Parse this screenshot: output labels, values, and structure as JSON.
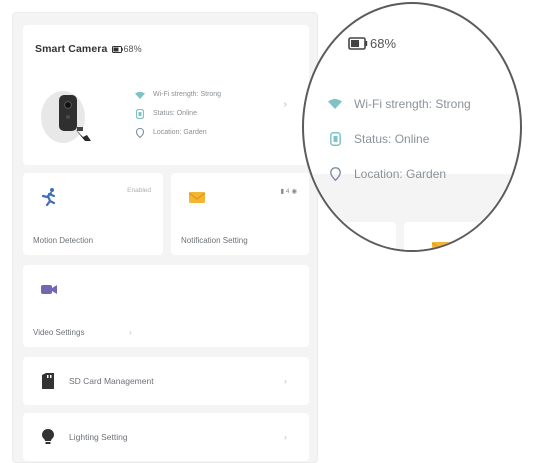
{
  "device": {
    "name": "Smart Camera",
    "battery": "68%",
    "info": [
      {
        "icon": "wifi-icon",
        "text": "Wi-Fi strength: Strong"
      },
      {
        "icon": "status-icon",
        "text": "Status: Online"
      },
      {
        "icon": "location-icon",
        "text": "Location: Garden"
      }
    ]
  },
  "tiles": {
    "motion": {
      "label": "Motion Detection",
      "state": "Enabled"
    },
    "notification": {
      "label": "Notification Setting",
      "badge": "4"
    },
    "video": {
      "label": "Video Settings"
    }
  },
  "rows": {
    "sd": {
      "label": "SD Card Management"
    },
    "lighting": {
      "label": "Lighting Setting"
    }
  },
  "zoom": {
    "battery": "68%",
    "info": [
      {
        "text": "Wi-Fi strength: Strong"
      },
      {
        "text": "Status: Online"
      },
      {
        "text": "Location: Garden"
      }
    ]
  },
  "colors": {
    "accent_blue": "#3f6fb6",
    "info_teal": "#7fc3c6",
    "notify_yellow": "#f2b632",
    "video_purple": "#7566b3"
  }
}
